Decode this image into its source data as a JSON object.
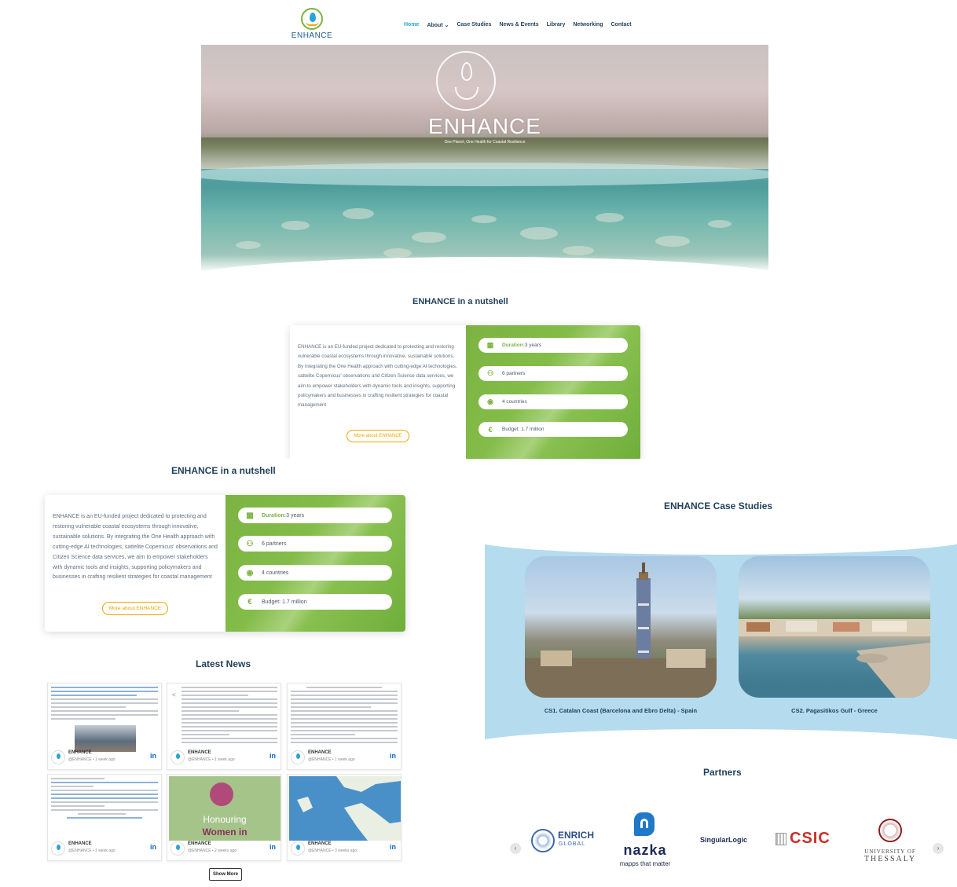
{
  "header": {
    "logo_text": "ENHANCE",
    "nav": [
      {
        "label": "Home"
      },
      {
        "label": "About ⌄"
      },
      {
        "label": "Case Studies"
      },
      {
        "label": "News & Events"
      },
      {
        "label": "Library"
      },
      {
        "label": "Networking"
      },
      {
        "label": "Contact"
      }
    ]
  },
  "hero": {
    "title": "ENHANCE",
    "subtitle": "One Planet, One Health for Coastal Resilience"
  },
  "nutshell": {
    "heading": "ENHANCE in a nutshell",
    "description": "ENHANCE is an EU-funded project dedicated to protecting and restoring vulnerable coastal ecosystems through innovative, sustainable solutions. By integrating the One Health approach with cutting-edge AI technologies, sattelite Copernicus' observations and Citizen Science data services, we aim to empower stakeholders with dynamic tools and insights, supporting policymakers and businesses in crafting resilient strategies for coastal management",
    "more_button": "More about ENHANCE",
    "facts": [
      {
        "icon": "calendar-icon",
        "glyph": "▦",
        "key": "Duration:",
        "value": " 3 years"
      },
      {
        "icon": "partners-icon",
        "glyph": "⚇",
        "key": "",
        "value": "6 partners"
      },
      {
        "icon": "globe-icon",
        "glyph": "◉",
        "key": "",
        "value": "4 countries"
      },
      {
        "icon": "euro-icon",
        "glyph": "€",
        "key": "",
        "value": "Budget: 1.7 million"
      }
    ]
  },
  "news": {
    "heading": "Latest News",
    "cards": [
      {
        "name": "ENHANCE",
        "meta": "@ENHANCE • 1 week ago"
      },
      {
        "name": "",
        "meta": ""
      },
      {
        "name": "ENHANCE",
        "meta": "@ENHANCE • 1 week ago"
      },
      {
        "name": "ENHANCE",
        "meta": "@ENHANCE • 1 week ago"
      },
      {
        "name": "ENHANCE",
        "meta": "@ENHANCE • 2 weeks ago"
      },
      {
        "name": "ENHANCE",
        "meta": "@ENHANCE • 3 weeks ago"
      }
    ],
    "card1_name": "ENHANCE",
    "card1_meta": "@ENHANCE • 1 week ago",
    "card2_name": "ENHANCE",
    "card2_meta": "@ENHANCE • 1 week ago",
    "card3_name": "ENHANCE",
    "card3_meta": "@ENHANCE • 1 week ago",
    "card4_name": "ENHANCE",
    "card4_meta": "@ENHANCE • 1 week ago",
    "card5_name": "ENHANCE",
    "card5_meta": "@ENHANCE • 2 weeks ago",
    "card6_name": "ENHANCE",
    "card6_meta": "@ENHANCE • 3 weeks ago",
    "honouring_title": "Honouring",
    "honouring_sub": "Women in",
    "linkedin": "in",
    "show_more": "Show More"
  },
  "case_studies": {
    "heading": "ENHANCE Case Studies",
    "items": [
      {
        "label": "CS1. Catalan Coast (Barcelona and Ebro Delta) - Spain"
      },
      {
        "label": "CS2. Pagasitikos Gulf - Greece"
      }
    ]
  },
  "partners": {
    "heading": "Partners",
    "enrich": "ENRICH",
    "enrich_sub": "GLOBAL",
    "nazka": "nazka",
    "nazka_tag": "mapps that matter",
    "singular": "SingularLogic",
    "csic": "CSIC",
    "thessaly_1": "UNIVERSITY OF",
    "thessaly_2": "THESSALY",
    "prev": "‹",
    "next": "›"
  },
  "colors": {
    "accent_green": "#7cb342",
    "accent_blue": "#29a3d8",
    "orange": "#f0a500",
    "heading": "#1f3f5b",
    "band_blue": "#b5dbee"
  }
}
